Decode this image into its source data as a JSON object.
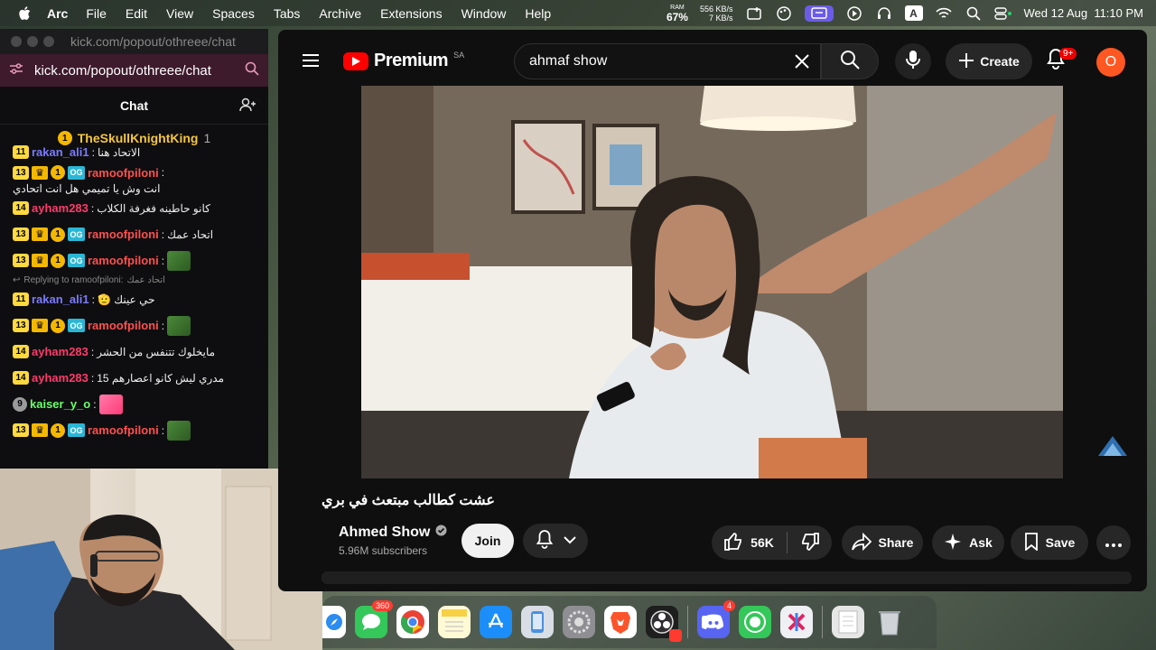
{
  "menubar": {
    "app": "Arc",
    "menus": [
      "File",
      "Edit",
      "View",
      "Spaces",
      "Tabs",
      "Archive",
      "Extensions",
      "Window",
      "Help"
    ],
    "ram_label": "RAM",
    "ram_value": "67%",
    "net_up": "556 KB/s",
    "net_down": "7 KB/s",
    "datetime": "Wed 12 Aug  11:10 PM"
  },
  "chat": {
    "window_url": "kick.com/popout/othreee/chat",
    "url": "kick.com/popout/othreee/chat",
    "header": "Chat",
    "pinned_user": "TheSkullKnightKing",
    "pinned_count": "1",
    "messages": [
      {
        "level": "11",
        "user": "rakan_ali1",
        "color": "#7b7bff",
        "text": "الاتحاد هنا",
        "badges": false
      },
      {
        "level": "13",
        "user": "ramoofpiloni",
        "color": "#ff4f4f",
        "text": "انت وش يا تميمي هل انت اتحادي",
        "badges": true
      },
      {
        "level": "14",
        "user": "ayham283",
        "color": "#ff3b6b",
        "text": "كانو حاطينه فغرفة الكلاب",
        "badges": false
      },
      {
        "level": "13",
        "user": "ramoofpiloni",
        "color": "#ff4f4f",
        "text": "اتحاد عمك",
        "badges": true
      },
      {
        "level": "13",
        "user": "ramoofpiloni",
        "color": "#ff4f4f",
        "text": "",
        "badges": true,
        "emote": true
      },
      {
        "level": "11",
        "user": "rakan_ali1",
        "color": "#7b7bff",
        "text": "حي عينك 🫡",
        "badges": false,
        "reply": "Replying to ramoofpiloni:",
        "reply_text": "اتحاد عمك"
      },
      {
        "level": "13",
        "user": "ramoofpiloni",
        "color": "#ff4f4f",
        "text": "",
        "badges": true,
        "emote": true
      },
      {
        "level": "14",
        "user": "ayham283",
        "color": "#ff3b6b",
        "text": "مايخلوك تتنفس من الحشر",
        "badges": false
      },
      {
        "level": "14",
        "user": "ayham283",
        "color": "#ff3b6b",
        "text": "مدري ليش كانو اعصارهم 15",
        "badges": false
      },
      {
        "level": "9",
        "user": "kaiser_y_o",
        "color": "#6bff6b",
        "text": "",
        "badges": false,
        "emote": true,
        "grey": true
      },
      {
        "level": "13",
        "user": "ramoofpiloni",
        "color": "#ff4f4f",
        "text": "",
        "badges": true,
        "emote": true
      }
    ]
  },
  "youtube": {
    "logo": "Premium",
    "country": "SA",
    "search_value": "ahmaf show",
    "create_label": "Create",
    "notif_badge": "9+",
    "avatar_letter": "O",
    "video_title": "عشت كطالب مبتعث في بري",
    "channel_name": "Ahmed Show",
    "subscribers": "5.96M subscribers",
    "join_label": "Join",
    "likes": "56K",
    "share_label": "Share",
    "ask_label": "Ask",
    "save_label": "Save"
  },
  "dock": {
    "messages_badge": "360",
    "discord_badge": "4"
  }
}
